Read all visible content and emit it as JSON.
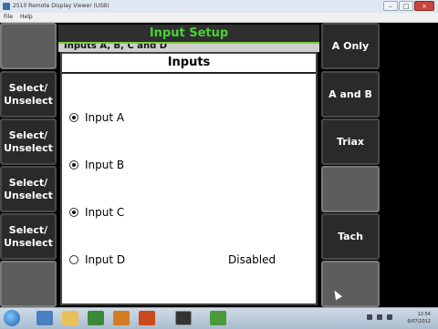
{
  "window": {
    "title": "2510 Remote Display Viewer (USB)",
    "buttons": [
      "–",
      "□",
      "×"
    ]
  },
  "menu": [
    "File",
    "Help"
  ],
  "header": {
    "title": "Input Setup",
    "subtitle_partial": "Inputs A, B, C and D"
  },
  "panel": {
    "title": "Inputs",
    "inputs": [
      {
        "label": "Input A",
        "selected": true,
        "status": ""
      },
      {
        "label": "Input B",
        "selected": true,
        "status": ""
      },
      {
        "label": "Input C",
        "selected": true,
        "status": ""
      },
      {
        "label": "Input D",
        "selected": false,
        "status": "Disabled"
      }
    ]
  },
  "left_softkeys": [
    {
      "label": ""
    },
    {
      "label": "Select/\nUnselect"
    },
    {
      "label": "Select/\nUnselect"
    },
    {
      "label": "Select/\nUnselect"
    },
    {
      "label": "Select/\nUnselect"
    },
    {
      "label": ""
    }
  ],
  "right_softkeys": [
    {
      "label": "A Only"
    },
    {
      "label": "A and B"
    },
    {
      "label": "Triax"
    },
    {
      "label": ""
    },
    {
      "label": "Tach"
    },
    {
      "label": ""
    }
  ],
  "taskbar": {
    "time": "12:54",
    "date": "6/07/2012"
  },
  "colors": {
    "header_text": "#49d136",
    "softkey_bg": "#2a2a2a",
    "softkey_blank_bg": "#5d5d5d"
  }
}
